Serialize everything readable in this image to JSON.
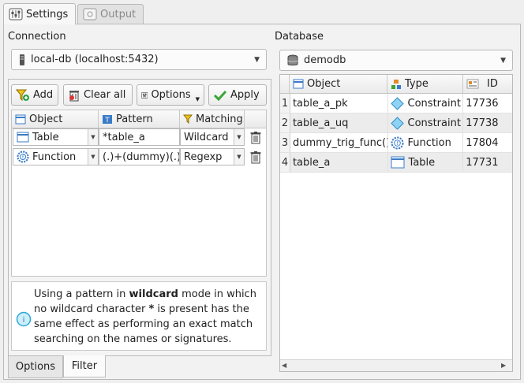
{
  "tabs": [
    {
      "label": "Settings",
      "active": true
    },
    {
      "label": "Output",
      "active": false
    }
  ],
  "connection": {
    "label": "Connection",
    "selected": "local-db (localhost:5432)"
  },
  "database": {
    "label": "Database",
    "selected": "demodb"
  },
  "toolbar": {
    "add": "Add",
    "clear_all": "Clear all",
    "options": "Options",
    "apply": "Apply"
  },
  "filter_table": {
    "headers": [
      "Object",
      "Pattern",
      "Matching"
    ],
    "rows": [
      {
        "object": "Table",
        "pattern": "*table_a",
        "matching": "Wildcard"
      },
      {
        "object": "Function",
        "pattern": "(.)+(dummy)(.)+",
        "matching": "Regexp"
      }
    ]
  },
  "info": {
    "text_before": "Using a pattern in ",
    "bold1": "wildcard",
    "text_mid": " mode in which no wildcard character ",
    "bold2": "*",
    "text_after": " is present has the same effect as performing an exact match searching on the names or signatures."
  },
  "bottom_tabs": [
    {
      "label": "Options",
      "active": false
    },
    {
      "label": "Filter",
      "active": true
    }
  ],
  "results": {
    "headers": [
      "Object",
      "Type",
      "ID"
    ],
    "rows": [
      {
        "num": "1",
        "object": "table_a_pk",
        "type": "Constraint",
        "id": "17736"
      },
      {
        "num": "2",
        "object": "table_a_uq",
        "type": "Constraint",
        "id": "17738"
      },
      {
        "num": "3",
        "object": "dummy_trig_func()",
        "type": "Function",
        "id": "17804"
      },
      {
        "num": "4",
        "object": "table_a",
        "type": "Table",
        "id": "17731"
      }
    ]
  },
  "colors": {
    "constraint_icon": "#3fb0e6",
    "table_icon": "#3a7bc8",
    "apply_check": "#3aa635",
    "info_icon": "#2fa7d8"
  }
}
